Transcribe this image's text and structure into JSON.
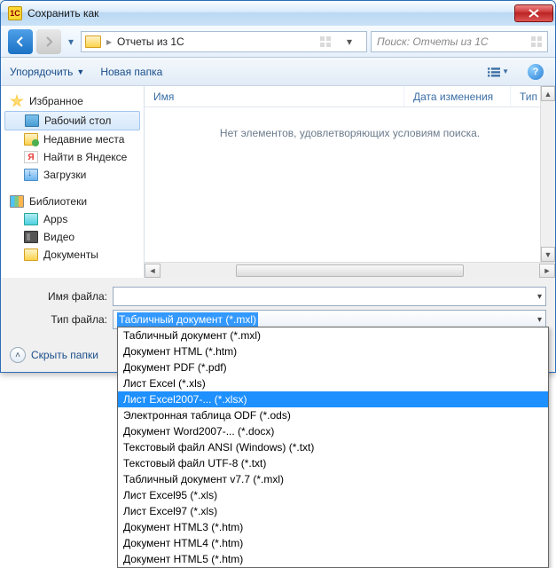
{
  "window": {
    "title": "Сохранить как",
    "app_icon_text": "1C"
  },
  "nav": {
    "breadcrumb": "Отчеты из 1С",
    "search_placeholder": "Поиск: Отчеты из 1С"
  },
  "toolbar": {
    "organize": "Упорядочить",
    "new_folder": "Новая папка"
  },
  "sidebar": {
    "favorites": {
      "label": "Избранное",
      "items": [
        {
          "label": "Рабочий стол"
        },
        {
          "label": "Недавние места"
        },
        {
          "label": "Найти в Яндексе"
        },
        {
          "label": "Загрузки"
        }
      ]
    },
    "libraries": {
      "label": "Библиотеки",
      "items": [
        {
          "label": "Apps"
        },
        {
          "label": "Видео"
        },
        {
          "label": "Документы"
        }
      ]
    }
  },
  "columns": {
    "name": "Имя",
    "date": "Дата изменения",
    "type": "Тип"
  },
  "empty_message": "Нет элементов, удовлетворяющих условиям поиска.",
  "fields": {
    "filename_label": "Имя файла:",
    "filename_value": "",
    "filetype_label": "Тип файла:",
    "filetype_selected": "Табличный документ (*.mxl)"
  },
  "footer": {
    "hide_folders": "Скрыть папки"
  },
  "type_options": [
    "Табличный документ (*.mxl)",
    "Документ HTML (*.htm)",
    "Документ PDF (*.pdf)",
    "Лист Excel (*.xls)",
    "Лист Excel2007-... (*.xlsx)",
    "Электронная таблица ODF (*.ods)",
    "Документ Word2007-... (*.docx)",
    "Текстовый файл ANSI (Windows) (*.txt)",
    "Текстовый файл UTF-8 (*.txt)",
    "Табличный документ v7.7 (*.mxl)",
    "Лист Excel95 (*.xls)",
    "Лист Excel97 (*.xls)",
    "Документ HTML3 (*.htm)",
    "Документ HTML4 (*.htm)",
    "Документ HTML5 (*.htm)"
  ],
  "type_selected_index": 4
}
